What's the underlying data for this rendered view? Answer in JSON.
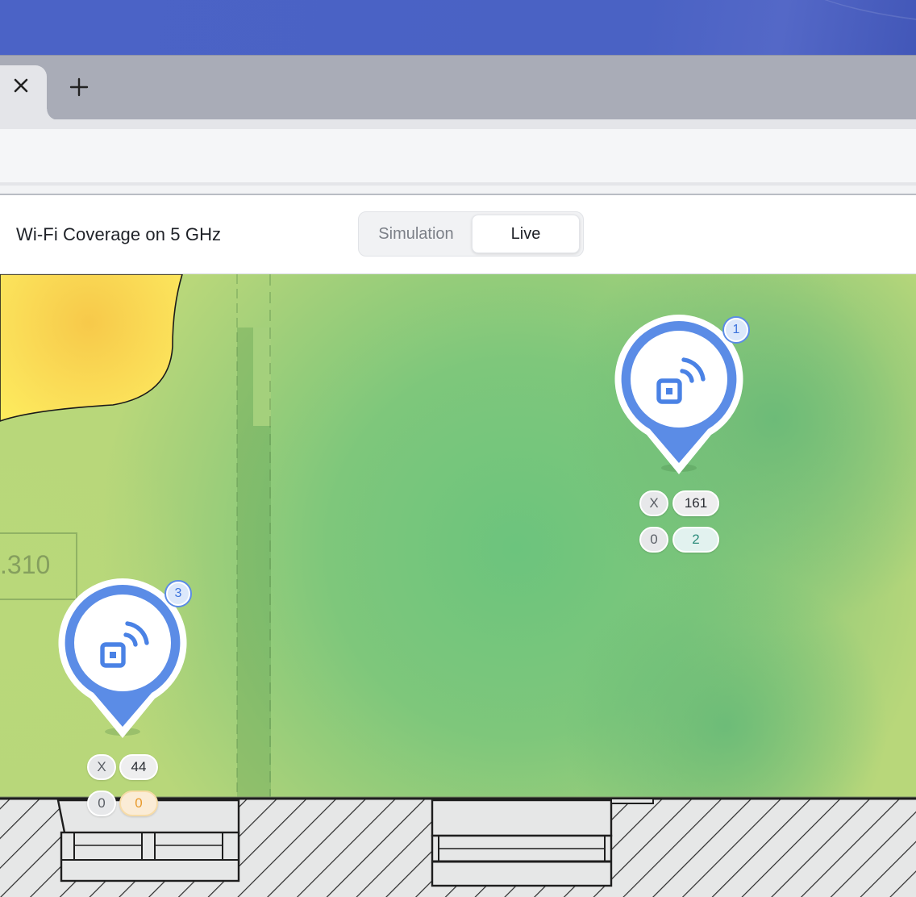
{
  "browser": {
    "tab_close_icon": "close-icon",
    "new_tab_icon": "plus-icon"
  },
  "header": {
    "title": "Wi-Fi Coverage on 5 GHz",
    "mode_options": [
      "Simulation",
      "Live"
    ],
    "selected_mode": "Live"
  },
  "map": {
    "room_label": ".310",
    "access_points": [
      {
        "number": "1",
        "icon": "access-point-icon",
        "stats": [
          [
            "X",
            "161"
          ],
          [
            "0",
            "2"
          ]
        ]
      },
      {
        "number": "3",
        "icon": "access-point-icon",
        "stats": [
          [
            "X",
            "44"
          ],
          [
            "0",
            "0"
          ]
        ]
      }
    ],
    "colors": {
      "coverage_green": "#7cc47a",
      "coverage_yellow": "#fdf060",
      "coverage_orange": "#f6c44a",
      "ap_blue": "#5b8ce6"
    }
  }
}
